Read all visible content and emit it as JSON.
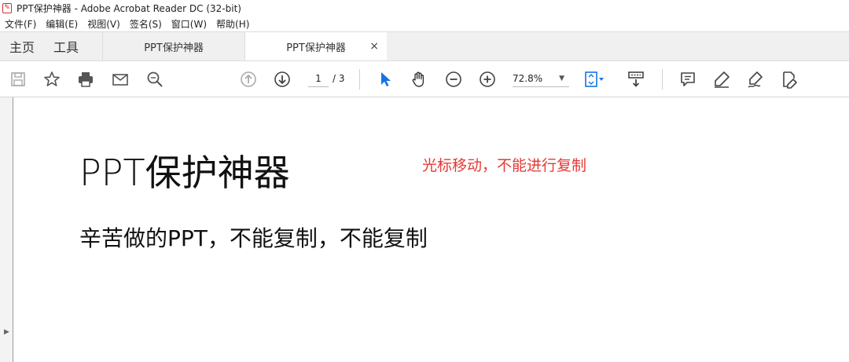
{
  "window": {
    "title": "PPT保护神器 - Adobe Acrobat Reader DC (32-bit)",
    "app_icon": "pdf-icon"
  },
  "menu": [
    "文件(F)",
    "编辑(E)",
    "视图(V)",
    "签名(S)",
    "窗口(W)",
    "帮助(H)"
  ],
  "tabs": {
    "home": "主页",
    "tools": "工具",
    "documents": [
      {
        "label": "PPT保护神器",
        "active": false
      },
      {
        "label": "PPT保护神器",
        "active": true,
        "close": "×"
      }
    ]
  },
  "toolbar": {
    "page_current": "1",
    "page_total": "/ 3",
    "zoom": "72.8%",
    "zoom_caret": "▼",
    "icons": [
      "save-icon",
      "star-icon",
      "print-icon",
      "email-icon",
      "zoom-search-icon",
      "prev-page-icon",
      "next-page-icon",
      "select-cursor-icon",
      "hand-icon",
      "zoom-out-icon",
      "zoom-in-icon",
      "fit-page-icon",
      "scroll-mode-icon",
      "comment-icon",
      "highlight-icon",
      "sign-icon",
      "edit-pdf-icon"
    ]
  },
  "colors": {
    "accent": "#1473e6",
    "warning_text": "#e53935",
    "tab_bg": "#f0f0f0"
  },
  "sidebar": {
    "toggle_arrow": "▶"
  },
  "document": {
    "heading": "PPT保护神器",
    "note": "光标移动，不能进行复制",
    "body": "辛苦做的PPT，不能复制，不能复制"
  }
}
